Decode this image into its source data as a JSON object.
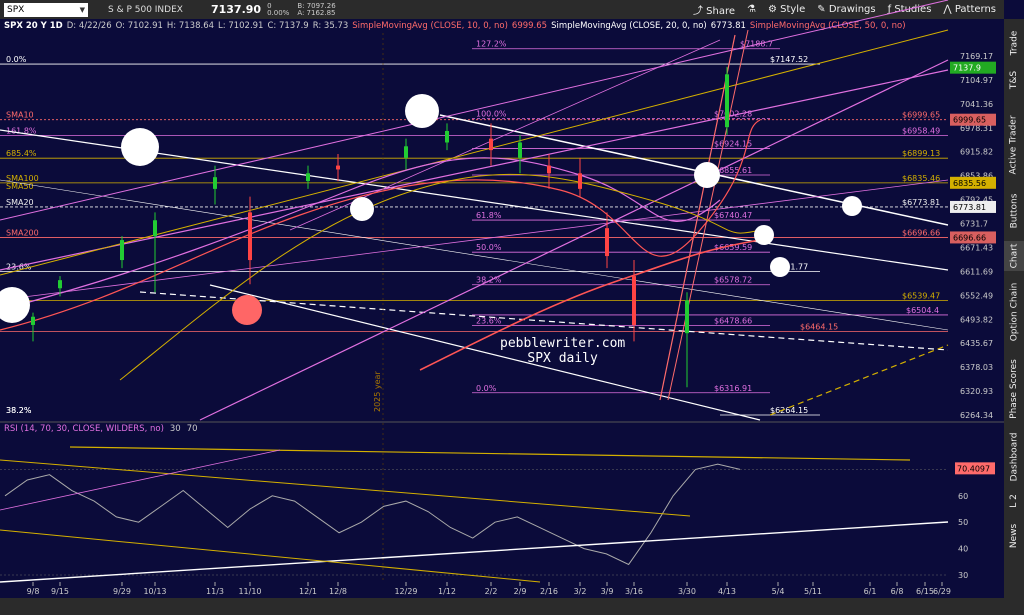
{
  "toolbar": {
    "symbol": "SPX",
    "name": "S & P 500 INDEX",
    "last": "7137.90",
    "change": "0",
    "change_pct": "0.00%",
    "bid": "B: 7097.26",
    "ask": "A: 7162.85",
    "buttons": [
      "Share",
      "Style",
      "Drawings",
      "Studies",
      "Patterns"
    ]
  },
  "sidebar": [
    "Trade",
    "T&S",
    "Active Trader",
    "Buttons",
    "Chart",
    "Option Chain",
    "Phase Scores",
    "Dashboard",
    "L 2",
    "News"
  ],
  "infobar": {
    "title": "SPX 20 Y 1D",
    "date": "D: 4/22/26",
    "open": "O: 7102.91",
    "high": "H: 7138.64",
    "low": "L: 7102.91",
    "close": "C: 7137.9",
    "range": "R: 35.73",
    "sma10": "SimpleMovingAvg (CLOSE, 10, 0, no)",
    "sma10_val": "6999.65",
    "sma20": "SimpleMovingAvg (CLOSE, 20, 0, no)",
    "sma20_val": "6773.81",
    "sma50": "SimpleMovingAvg (CLOSE, 50, 0, no)"
  },
  "watermark": {
    "line1": "pebblewriter.com",
    "line2": "SPX daily"
  },
  "rotated_label": "2025 year",
  "chart_data": [
    {
      "type": "candlestick",
      "title": "SPX 20 Y 1D",
      "x_tick_labels": [
        "9/8",
        "9/15",
        "9/29",
        "10/13",
        "11/3",
        "11/10",
        "12/1",
        "12/8",
        "12/29",
        "1/12",
        "2/2",
        "2/9",
        "2/16",
        "3/2",
        "3/9",
        "3/16",
        "3/30",
        "4/13",
        "5/4",
        "5/11",
        "6/1",
        "6/8",
        "6/15",
        "6/29"
      ],
      "y_tick_labels": [
        "7169.17",
        "7104.97",
        "7041.36",
        "6978.31",
        "6915.82",
        "6853.86",
        "6792.45",
        "6731.7",
        "6671.43",
        "6611.69",
        "6552.49",
        "6493.82",
        "6435.67",
        "6378.03",
        "6320.93",
        "6264.34"
      ],
      "price_tags": [
        {
          "label": "7137.9",
          "color": "#22aa22"
        },
        {
          "label": "6999.65",
          "color": "#d95f5f"
        },
        {
          "label": "6835.56",
          "color": "#d4b000"
        },
        {
          "label": "6773.81",
          "color": "#eeeeee"
        },
        {
          "label": "6696.66",
          "color": "#d95f5f"
        }
      ],
      "moving_average_labels": [
        {
          "name": "SMA10",
          "color": "#ff5555"
        },
        {
          "name": "SMA100",
          "color": "#ffffff"
        },
        {
          "name": "SMA50",
          "color": "#d4b000"
        },
        {
          "name": "SMA20",
          "color": "#ffffff"
        },
        {
          "name": "SMA200",
          "color": "#ff5555"
        }
      ],
      "annotations": [
        {
          "text": "127.2%",
          "color": "#e070e0"
        },
        {
          "text": "$7188.7",
          "color": "#ffffff"
        },
        {
          "text": "$7147.52",
          "color": "#ffffff"
        },
        {
          "text": "0.0%",
          "color": "#ffffff"
        },
        {
          "text": "100.0%",
          "color": "#e070e0"
        },
        {
          "text": "$7002.28",
          "color": "#e070e0"
        },
        {
          "text": "$6999.65",
          "color": "#ff6b6b"
        },
        {
          "text": "161.8%",
          "color": "#e070e0"
        },
        {
          "text": "$6958.49",
          "color": "#e070e0"
        },
        {
          "text": "$6924.15",
          "color": "#e070e0"
        },
        {
          "text": "685.4%",
          "color": "#d4b000"
        },
        {
          "text": "$6899.13",
          "color": "#d4b000"
        },
        {
          "text": "$6855.61",
          "color": "#e070e0"
        },
        {
          "text": "$6835.46",
          "color": "#d4b000"
        },
        {
          "text": "$6773.81",
          "color": "#eeeeee"
        },
        {
          "text": "61.8%",
          "color": "#e070e0"
        },
        {
          "text": "$6740.47",
          "color": "#e070e0"
        },
        {
          "text": "$6696.66",
          "color": "#ff6b6b"
        },
        {
          "text": "50.0%",
          "color": "#e070e0"
        },
        {
          "text": "$6659.59",
          "color": "#e070e0"
        },
        {
          "text": "23.6%",
          "color": "#ffffff"
        },
        {
          "text": "$6611.77",
          "color": "#ffffff"
        },
        {
          "text": "38.2%",
          "color": "#e070e0"
        },
        {
          "text": "$6578.72",
          "color": "#e070e0"
        },
        {
          "text": "$6539.47",
          "color": "#d4b000"
        },
        {
          "text": "$6504.4",
          "color": "#e070e0"
        },
        {
          "text": "23.6%",
          "color": "#e070e0"
        },
        {
          "text": "$6478.66",
          "color": "#e070e0"
        },
        {
          "text": "$6464.15",
          "color": "#ff6b6b"
        },
        {
          "text": "0.0%",
          "color": "#e070e0"
        },
        {
          "text": "$6316.91",
          "color": "#e070e0"
        },
        {
          "text": "38.2%",
          "color": "#ffffff"
        },
        {
          "text": "$6264.15",
          "color": "#ffffff"
        }
      ],
      "ohlc": [
        {
          "x": "9/8",
          "o": 6480,
          "h": 6510,
          "l": 6440,
          "c": 6500
        },
        {
          "x": "9/15",
          "o": 6570,
          "h": 6600,
          "l": 6550,
          "c": 6590
        },
        {
          "x": "9/29",
          "o": 6640,
          "h": 6700,
          "l": 6620,
          "c": 6690
        },
        {
          "x": "10/13",
          "o": 6700,
          "h": 6760,
          "l": 6560,
          "c": 6740
        },
        {
          "x": "11/3",
          "o": 6820,
          "h": 6880,
          "l": 6780,
          "c": 6850
        },
        {
          "x": "11/10",
          "o": 6760,
          "h": 6800,
          "l": 6580,
          "c": 6640
        },
        {
          "x": "12/1",
          "o": 6840,
          "h": 6880,
          "l": 6820,
          "c": 6860
        },
        {
          "x": "12/8",
          "o": 6880,
          "h": 6910,
          "l": 6840,
          "c": 6870
        },
        {
          "x": "12/29",
          "o": 6900,
          "h": 6950,
          "l": 6870,
          "c": 6930
        },
        {
          "x": "1/12",
          "o": 6940,
          "h": 6990,
          "l": 6920,
          "c": 6970
        },
        {
          "x": "2/2",
          "o": 6950,
          "h": 6990,
          "l": 6880,
          "c": 6920
        },
        {
          "x": "2/9",
          "o": 6900,
          "h": 6960,
          "l": 6860,
          "c": 6940
        },
        {
          "x": "2/16",
          "o": 6880,
          "h": 6910,
          "l": 6820,
          "c": 6860
        },
        {
          "x": "3/2",
          "o": 6860,
          "h": 6900,
          "l": 6800,
          "c": 6820
        },
        {
          "x": "3/9",
          "o": 6720,
          "h": 6760,
          "l": 6620,
          "c": 6650
        },
        {
          "x": "3/16",
          "o": 6600,
          "h": 6640,
          "l": 6440,
          "c": 6480
        },
        {
          "x": "3/30",
          "o": 6460,
          "h": 6560,
          "l": 6330,
          "c": 6540
        },
        {
          "x": "4/13",
          "o": 6980,
          "h": 7140,
          "l": 6960,
          "c": 7120
        }
      ],
      "ylim": [
        6264.34,
        7169.17
      ]
    },
    {
      "type": "line",
      "title": "RSI (14, 70, 30, CLOSE, WILDERS, no)",
      "current": "70.4097",
      "levels": [
        "30",
        "70"
      ],
      "y_tick_labels": [
        "70",
        "60",
        "50",
        "40",
        "30"
      ],
      "ylim": [
        30,
        80
      ],
      "series": [
        {
          "values": [
            60,
            66,
            68,
            62,
            58,
            52,
            50,
            56,
            62,
            55,
            48,
            55,
            60,
            58,
            52,
            46,
            50,
            56,
            58,
            54,
            48,
            44,
            50,
            52,
            48,
            44,
            40,
            38,
            34,
            46,
            60,
            70,
            72,
            70
          ]
        }
      ]
    }
  ]
}
